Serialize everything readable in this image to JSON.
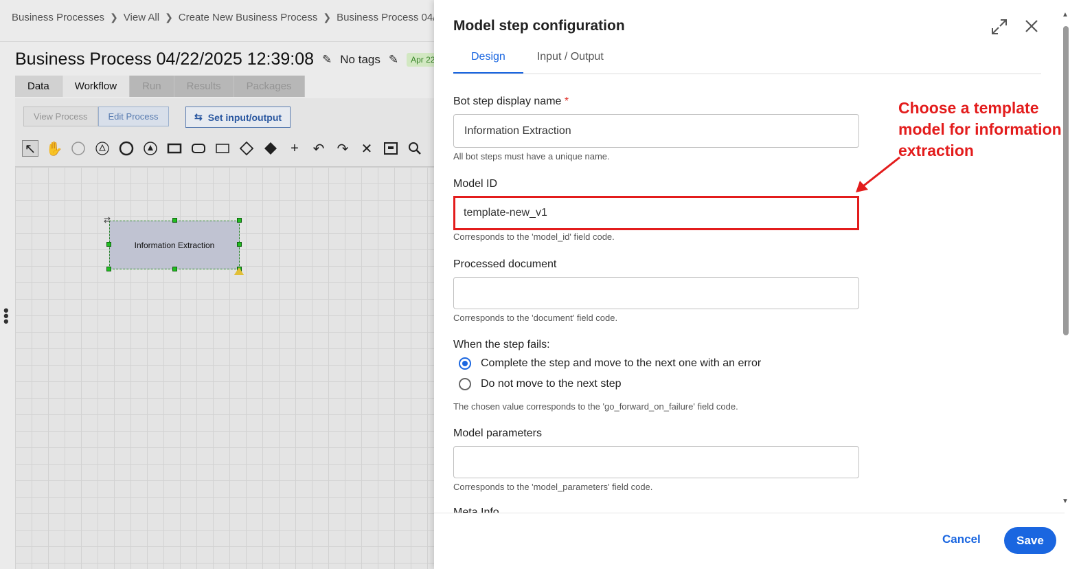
{
  "background": {
    "breadcrumbs": [
      "Business Processes",
      "View All",
      "Create New Business Process",
      "Business Process 04/"
    ],
    "process_title": "Business Process 04/22/2025 12:39:08",
    "tags_label": "No tags",
    "date_badge": "Apr 22",
    "tabs": [
      "Data",
      "Workflow",
      "Run",
      "Results",
      "Packages"
    ],
    "view_buttons": [
      "View Process",
      "Edit Process"
    ],
    "io_button": "Set input/output",
    "node_label": "Information Extraction"
  },
  "panel": {
    "title": "Model step configuration",
    "tabs": [
      "Design",
      "Input / Output"
    ],
    "display_name": {
      "label": "Bot step display name",
      "required_mark": "*",
      "value": "Information Extraction",
      "help": "All bot steps must have a unique name."
    },
    "model_id": {
      "label": "Model ID",
      "value": "template-new_v1",
      "help": "Corresponds to the 'model_id' field code."
    },
    "processed_document": {
      "label": "Processed document",
      "value": "",
      "help": "Corresponds to the 'document' field code."
    },
    "failure": {
      "label": "When the step fails:",
      "options": [
        "Complete the step and move to the next one with an error",
        "Do not move to the next step"
      ],
      "selected": 0,
      "help": "The chosen value corresponds to the 'go_forward_on_failure' field code."
    },
    "model_parameters": {
      "label": "Model parameters",
      "value": "",
      "help": "Corresponds to the 'model_parameters' field code."
    },
    "next_section_label": "Meta Info",
    "cancel_label": "Cancel",
    "save_label": "Save"
  },
  "annotation": {
    "text": "Choose a template model for information extraction",
    "color": "#e31c1c"
  },
  "colors": {
    "accent": "#1a66e0"
  }
}
